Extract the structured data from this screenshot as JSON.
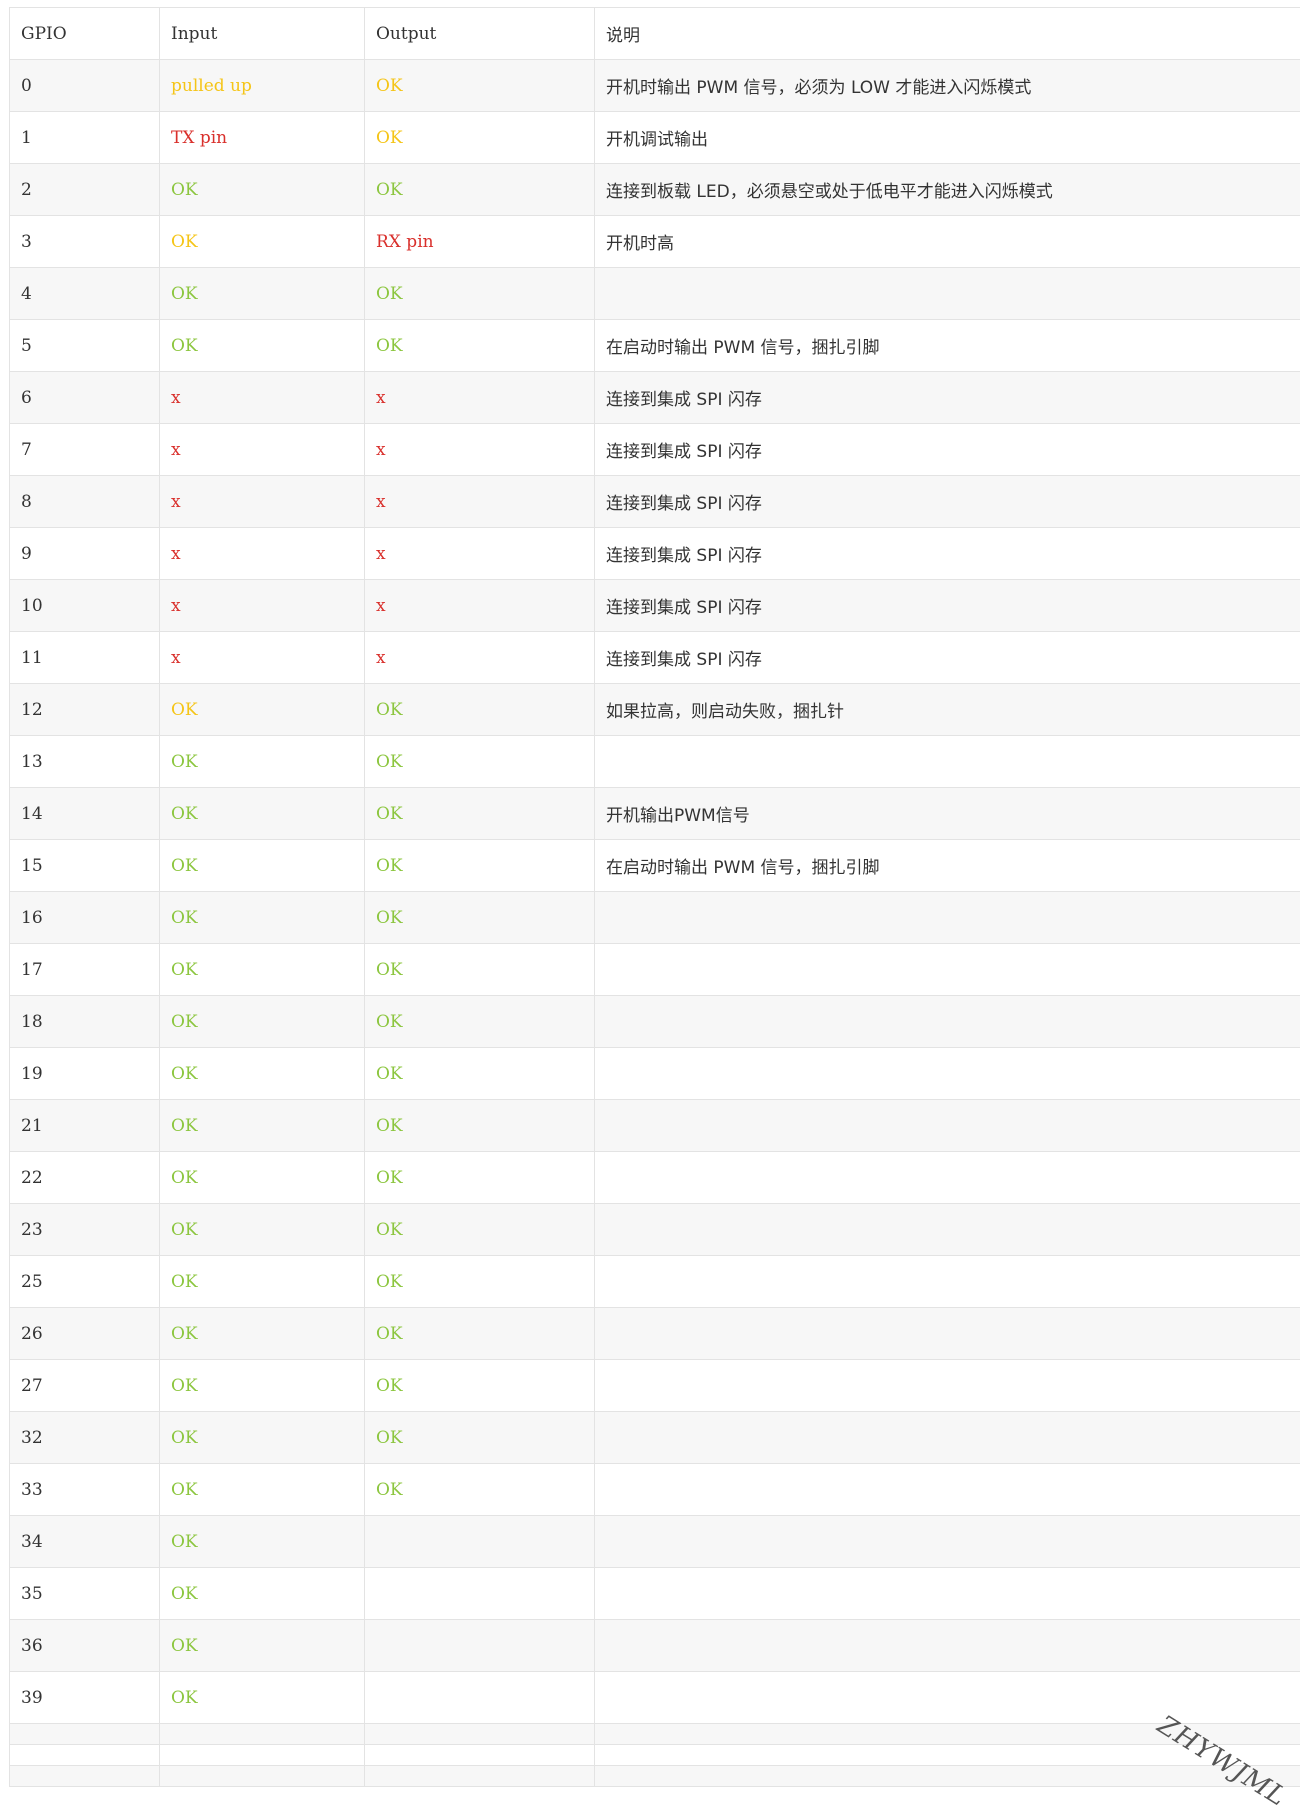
{
  "colors": {
    "ok": "#8cc63f",
    "warn": "#f5c518",
    "bad": "#d9302c",
    "text": "#333333",
    "stripe": "#f7f7f7",
    "border": "#e3e3e3"
  },
  "table": {
    "headers": [
      "GPIO",
      "Input",
      "Output",
      "说明"
    ],
    "rows": [
      {
        "gpio": "0",
        "input": "pulled up",
        "input_status": "warn",
        "output": "OK",
        "output_status": "warn",
        "note": "开机时输出 PWM 信号，必须为 LOW 才能进入闪烁模式"
      },
      {
        "gpio": "1",
        "input": "TX pin",
        "input_status": "bad",
        "output": "OK",
        "output_status": "warn",
        "note": "开机调试输出"
      },
      {
        "gpio": "2",
        "input": "OK",
        "input_status": "ok",
        "output": "OK",
        "output_status": "ok",
        "note": "连接到板载 LED，必须悬空或处于低电平才能进入闪烁模式"
      },
      {
        "gpio": "3",
        "input": "OK",
        "input_status": "warn",
        "output": "RX pin",
        "output_status": "bad",
        "note": "开机时高"
      },
      {
        "gpio": "4",
        "input": "OK",
        "input_status": "ok",
        "output": "OK",
        "output_status": "ok",
        "note": ""
      },
      {
        "gpio": "5",
        "input": "OK",
        "input_status": "ok",
        "output": "OK",
        "output_status": "ok",
        "note": "在启动时输出 PWM 信号，捆扎引脚"
      },
      {
        "gpio": "6",
        "input": "x",
        "input_status": "bad",
        "output": "x",
        "output_status": "bad",
        "note": "连接到集成 SPI 闪存"
      },
      {
        "gpio": "7",
        "input": "x",
        "input_status": "bad",
        "output": "x",
        "output_status": "bad",
        "note": "连接到集成 SPI 闪存"
      },
      {
        "gpio": "8",
        "input": "x",
        "input_status": "bad",
        "output": "x",
        "output_status": "bad",
        "note": "连接到集成 SPI 闪存"
      },
      {
        "gpio": "9",
        "input": "x",
        "input_status": "bad",
        "output": "x",
        "output_status": "bad",
        "note": "连接到集成 SPI 闪存"
      },
      {
        "gpio": "10",
        "input": "x",
        "input_status": "bad",
        "output": "x",
        "output_status": "bad",
        "note": "连接到集成 SPI 闪存"
      },
      {
        "gpio": "11",
        "input": "x",
        "input_status": "bad",
        "output": "x",
        "output_status": "bad",
        "note": "连接到集成 SPI 闪存"
      },
      {
        "gpio": "12",
        "input": "OK",
        "input_status": "warn",
        "output": "OK",
        "output_status": "ok",
        "note": "如果拉高，则启动失败，捆扎针"
      },
      {
        "gpio": "13",
        "input": "OK",
        "input_status": "ok",
        "output": "OK",
        "output_status": "ok",
        "note": ""
      },
      {
        "gpio": "14",
        "input": "OK",
        "input_status": "ok",
        "output": "OK",
        "output_status": "ok",
        "note": "开机输出PWM信号"
      },
      {
        "gpio": "15",
        "input": "OK",
        "input_status": "ok",
        "output": "OK",
        "output_status": "ok",
        "note": "在启动时输出 PWM 信号，捆扎引脚"
      },
      {
        "gpio": "16",
        "input": "OK",
        "input_status": "ok",
        "output": "OK",
        "output_status": "ok",
        "note": ""
      },
      {
        "gpio": "17",
        "input": "OK",
        "input_status": "ok",
        "output": "OK",
        "output_status": "ok",
        "note": ""
      },
      {
        "gpio": "18",
        "input": "OK",
        "input_status": "ok",
        "output": "OK",
        "output_status": "ok",
        "note": ""
      },
      {
        "gpio": "19",
        "input": "OK",
        "input_status": "ok",
        "output": "OK",
        "output_status": "ok",
        "note": ""
      },
      {
        "gpio": "21",
        "input": "OK",
        "input_status": "ok",
        "output": "OK",
        "output_status": "ok",
        "note": ""
      },
      {
        "gpio": "22",
        "input": "OK",
        "input_status": "ok",
        "output": "OK",
        "output_status": "ok",
        "note": ""
      },
      {
        "gpio": "23",
        "input": "OK",
        "input_status": "ok",
        "output": "OK",
        "output_status": "ok",
        "note": ""
      },
      {
        "gpio": "25",
        "input": "OK",
        "input_status": "ok",
        "output": "OK",
        "output_status": "ok",
        "note": ""
      },
      {
        "gpio": "26",
        "input": "OK",
        "input_status": "ok",
        "output": "OK",
        "output_status": "ok",
        "note": ""
      },
      {
        "gpio": "27",
        "input": "OK",
        "input_status": "ok",
        "output": "OK",
        "output_status": "ok",
        "note": ""
      },
      {
        "gpio": "32",
        "input": "OK",
        "input_status": "ok",
        "output": "OK",
        "output_status": "ok",
        "note": ""
      },
      {
        "gpio": "33",
        "input": "OK",
        "input_status": "ok",
        "output": "OK",
        "output_status": "ok",
        "note": ""
      },
      {
        "gpio": "34",
        "input": "OK",
        "input_status": "ok",
        "output": "",
        "output_status": "ok",
        "note": ""
      },
      {
        "gpio": "35",
        "input": "OK",
        "input_status": "ok",
        "output": "",
        "output_status": "ok",
        "note": ""
      },
      {
        "gpio": "36",
        "input": "OK",
        "input_status": "ok",
        "output": "",
        "output_status": "ok",
        "note": ""
      },
      {
        "gpio": "39",
        "input": "OK",
        "input_status": "ok",
        "output": "",
        "output_status": "ok",
        "note": ""
      },
      {
        "gpio": "",
        "input": "",
        "input_status": "ok",
        "output": "",
        "output_status": "ok",
        "note": "",
        "empty": true
      },
      {
        "gpio": "",
        "input": "",
        "input_status": "ok",
        "output": "",
        "output_status": "ok",
        "note": "",
        "empty": true
      },
      {
        "gpio": "",
        "input": "",
        "input_status": "ok",
        "output": "",
        "output_status": "ok",
        "note": "",
        "empty": true
      }
    ]
  },
  "watermark": "ZHYWJML"
}
